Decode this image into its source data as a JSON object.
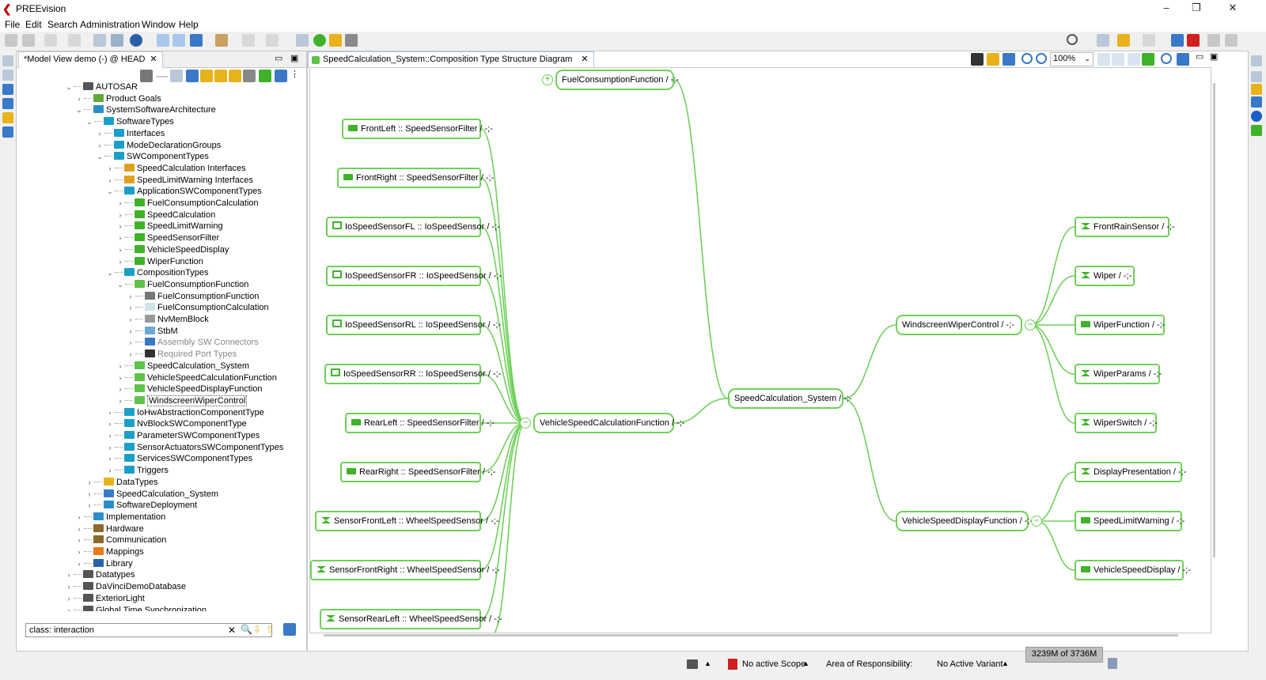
{
  "app": {
    "title": "PREEvision"
  },
  "window_buttons": [
    "–",
    "❐",
    "✕"
  ],
  "menu": [
    "File",
    "Edit",
    "Search",
    "Administration",
    "Window",
    "Help"
  ],
  "left_panel": {
    "tab_label": "*Model View demo (-) @ HEAD",
    "tab_close": "✕",
    "filter_value": "class: interaction",
    "tree": [
      {
        "label": "AUTOSAR",
        "depth": 0,
        "exp": "⌄",
        "icon": "#555555"
      },
      {
        "label": "Product Goals",
        "depth": 1,
        "exp": "›",
        "icon": "#5fa83a"
      },
      {
        "label": "SystemSoftwareArchitecture",
        "depth": 1,
        "exp": "⌄",
        "icon": "#2a8fc9"
      },
      {
        "label": "SoftwareTypes",
        "depth": 2,
        "exp": "⌄",
        "icon": "#1aa0c8"
      },
      {
        "label": "Interfaces",
        "depth": 3,
        "exp": "›",
        "icon": "#1aa0c8"
      },
      {
        "label": "ModeDeclarationGroups",
        "depth": 3,
        "exp": "›",
        "icon": "#1aa0c8"
      },
      {
        "label": "SWComponentTypes",
        "depth": 3,
        "exp": "⌄",
        "icon": "#1aa0c8"
      },
      {
        "label": "SpeedCalculation Interfaces",
        "depth": 4,
        "exp": "›",
        "icon": "#e0a020"
      },
      {
        "label": "SpeedLimitWarning Interfaces",
        "depth": 4,
        "exp": "›",
        "icon": "#e0a020"
      },
      {
        "label": "ApplicationSWComponentTypes",
        "depth": 4,
        "exp": "⌄",
        "icon": "#1aa0c8"
      },
      {
        "label": "FuelConsumptionCalculation",
        "depth": 5,
        "exp": "›",
        "icon": "#3fb22a"
      },
      {
        "label": "SpeedCalculation",
        "depth": 5,
        "exp": "›",
        "icon": "#3fb22a"
      },
      {
        "label": "SpeedLimitWarning",
        "depth": 5,
        "exp": "›",
        "icon": "#3fb22a"
      },
      {
        "label": "SpeedSensorFilter",
        "depth": 5,
        "exp": "›",
        "icon": "#3fb22a"
      },
      {
        "label": "VehicleSpeedDisplay",
        "depth": 5,
        "exp": "›",
        "icon": "#3fb22a"
      },
      {
        "label": "WiperFunction",
        "depth": 5,
        "exp": "›",
        "icon": "#3fb22a"
      },
      {
        "label": "CompositionTypes",
        "depth": 4,
        "exp": "⌄",
        "icon": "#1aa0c8"
      },
      {
        "label": "FuelConsumptionFunction",
        "depth": 5,
        "exp": "⌄",
        "icon": "#5fc24a"
      },
      {
        "label": "FuelConsumptionFunction",
        "depth": 6,
        "exp": "›",
        "icon": "#777777"
      },
      {
        "label": "FuelConsumptionCalculation",
        "depth": 6,
        "exp": "›",
        "icon": "#cfe3e8"
      },
      {
        "label": "NvMemBlock",
        "depth": 6,
        "exp": "›",
        "icon": "#999999"
      },
      {
        "label": "StbM",
        "depth": 6,
        "exp": "›",
        "icon": "#6aa8d8"
      },
      {
        "label": "Assembly SW Connectors",
        "depth": 6,
        "exp": "›",
        "icon": "#3a78c8",
        "disabled": true
      },
      {
        "label": "Required Port Types",
        "depth": 6,
        "exp": "›",
        "icon": "#333333",
        "disabled": true
      },
      {
        "label": "SpeedCalculation_System",
        "depth": 5,
        "exp": "›",
        "icon": "#5fc24a"
      },
      {
        "label": "VehicleSpeedCalculationFunction",
        "depth": 5,
        "exp": "›",
        "icon": "#5fc24a"
      },
      {
        "label": "VehicleSpeedDisplayFunction",
        "depth": 5,
        "exp": "›",
        "icon": "#5fc24a"
      },
      {
        "label": "WindscreenWiperControl",
        "depth": 5,
        "exp": "›",
        "icon": "#5fc24a",
        "selected": true
      },
      {
        "label": "IoHwAbstractionComponentType",
        "depth": 4,
        "exp": "›",
        "icon": "#1aa0c8"
      },
      {
        "label": "NvBlockSWComponentType",
        "depth": 4,
        "exp": "›",
        "icon": "#1aa0c8"
      },
      {
        "label": "ParameterSWComponentTypes",
        "depth": 4,
        "exp": "›",
        "icon": "#1aa0c8"
      },
      {
        "label": "SensorActuatorsSWComponentTypes",
        "depth": 4,
        "exp": "›",
        "icon": "#1aa0c8"
      },
      {
        "label": "ServicesSWComponentTypes",
        "depth": 4,
        "exp": "›",
        "icon": "#1aa0c8"
      },
      {
        "label": "Triggers",
        "depth": 4,
        "exp": "›",
        "icon": "#1aa0c8"
      },
      {
        "label": "DataTypes",
        "depth": 2,
        "exp": "›",
        "icon": "#e8b21a"
      },
      {
        "label": "SpeedCalculation_System",
        "depth": 2,
        "exp": "›",
        "icon": "#3a78c8"
      },
      {
        "label": "SoftwareDeployment",
        "depth": 2,
        "exp": "›",
        "icon": "#2a8fc9"
      },
      {
        "label": "Implementation",
        "depth": 1,
        "exp": "›",
        "icon": "#2a8fc9"
      },
      {
        "label": "Hardware",
        "depth": 1,
        "exp": "›",
        "icon": "#8a6a2a"
      },
      {
        "label": "Communication",
        "depth": 1,
        "exp": "›",
        "icon": "#8a6a2a"
      },
      {
        "label": "Mappings",
        "depth": 1,
        "exp": "›",
        "icon": "#e87a1a"
      },
      {
        "label": "Library",
        "depth": 1,
        "exp": "›",
        "icon": "#2a5fa8"
      },
      {
        "label": "Datatypes",
        "depth": 0,
        "exp": "›",
        "icon": "#555555"
      },
      {
        "label": "DaVinciDemoDatabase",
        "depth": 0,
        "exp": "›",
        "icon": "#555555"
      },
      {
        "label": "ExteriorLight",
        "depth": 0,
        "exp": "›",
        "icon": "#555555"
      },
      {
        "label": "Global Time Synchronization",
        "depth": 0,
        "exp": "›",
        "icon": "#555555"
      }
    ]
  },
  "diagram": {
    "tab_label": "SpeedCalculation_System::Composition Type Structure Diagram",
    "tab_close": "✕",
    "zoom": "100%",
    "accent": "#6fd05a",
    "nodes": [
      {
        "id": "fuel",
        "label": "FuelConsumptionFunction / -;-",
        "icon": "none",
        "big": true
      },
      {
        "id": "fl",
        "label": "FrontLeft :: SpeedSensorFilter / -;-",
        "icon": "comp"
      },
      {
        "id": "fr",
        "label": "FrontRight :: SpeedSensorFilter / -;-",
        "icon": "comp"
      },
      {
        "id": "iofl",
        "label": "IoSpeedSensorFL :: IoSpeedSensor / -;-",
        "icon": "io"
      },
      {
        "id": "iofr",
        "label": "IoSpeedSensorFR :: IoSpeedSensor / -;-",
        "icon": "io"
      },
      {
        "id": "iorl",
        "label": "IoSpeedSensorRL :: IoSpeedSensor / -;-",
        "icon": "io"
      },
      {
        "id": "iorr",
        "label": "IoSpeedSensorRR :: IoSpeedSensor / -;-",
        "icon": "io"
      },
      {
        "id": "rl",
        "label": "RearLeft :: SpeedSensorFilter / -;-",
        "icon": "comp"
      },
      {
        "id": "rr",
        "label": "RearRight :: SpeedSensorFilter / -;-",
        "icon": "comp"
      },
      {
        "id": "sfl",
        "label": "SensorFrontLeft :: WheelSpeedSensor / -;-",
        "icon": "sensor"
      },
      {
        "id": "sfr",
        "label": "SensorFrontRight :: WheelSpeedSensor / -;-",
        "icon": "sensor"
      },
      {
        "id": "srl",
        "label": "SensorRearLeft :: WheelSpeedSensor / -;-",
        "icon": "sensor"
      },
      {
        "id": "vscf",
        "label": "VehicleSpeedCalculationFunction / -;-",
        "icon": "none",
        "big": true
      },
      {
        "id": "scs",
        "label": "SpeedCalculation_System / -;-",
        "icon": "none",
        "big": true
      },
      {
        "id": "wwc",
        "label": "WindscreenWiperControl / -;-",
        "icon": "none",
        "big": true
      },
      {
        "id": "vsdf",
        "label": "VehicleSpeedDisplayFunction / -;-",
        "icon": "none",
        "big": true
      },
      {
        "id": "frs",
        "label": "FrontRainSensor / -;-",
        "icon": "sensor"
      },
      {
        "id": "wiper",
        "label": "Wiper / -;-",
        "icon": "sensor"
      },
      {
        "id": "wf",
        "label": "WiperFunction / -;-",
        "icon": "comp"
      },
      {
        "id": "wp",
        "label": "WiperParams / -;-",
        "icon": "sensor"
      },
      {
        "id": "ws",
        "label": "WiperSwitch / -;-",
        "icon": "sensor"
      },
      {
        "id": "dp",
        "label": "DisplayPresentation / -;-",
        "icon": "sensor"
      },
      {
        "id": "slw",
        "label": "SpeedLimitWarning / -;-",
        "icon": "comp"
      },
      {
        "id": "vsd",
        "label": "VehicleSpeedDisplay / -;-",
        "icon": "comp"
      }
    ]
  },
  "status": {
    "scope": "No active Scope",
    "area": "Area of Responsibility:",
    "area_value": "-",
    "variant": "No Active Variant",
    "memory": "3239M of 3736M"
  }
}
